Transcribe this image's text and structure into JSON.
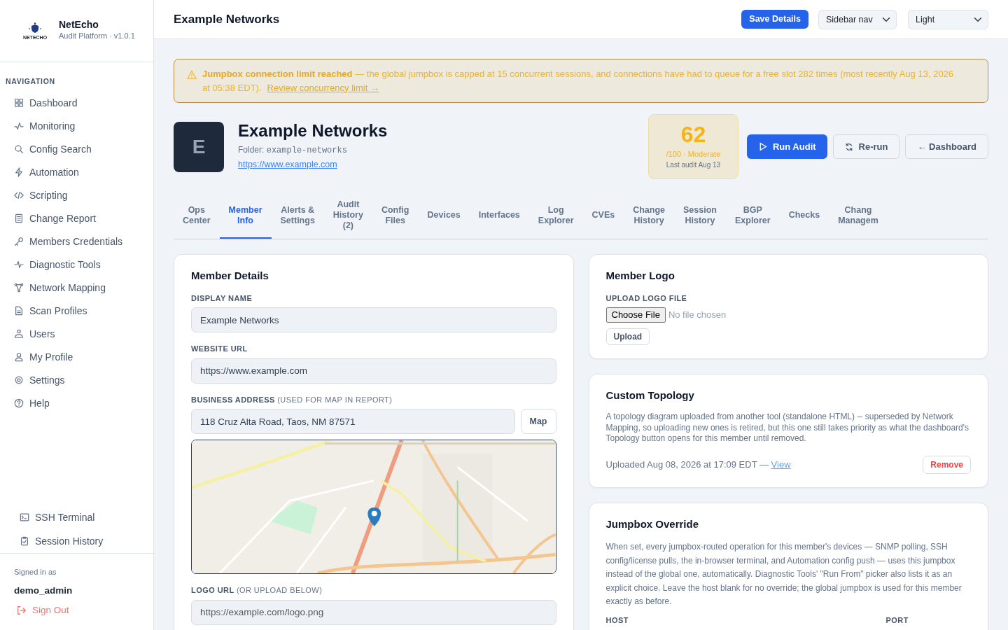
{
  "brand": {
    "logo_text": "NETECHO",
    "name": "NetEcho",
    "subtitle": "Audit Platform · v1.0.1"
  },
  "sidebar": {
    "heading": "NAVIGATION",
    "items": [
      {
        "label": "Dashboard"
      },
      {
        "label": "Monitoring"
      },
      {
        "label": "Config Search"
      },
      {
        "label": "Automation"
      },
      {
        "label": "Scripting"
      },
      {
        "label": "Change Report"
      },
      {
        "label": "Members Credentials"
      },
      {
        "label": "Diagnostic Tools"
      },
      {
        "label": "Network Mapping"
      },
      {
        "label": "Scan Profiles"
      },
      {
        "label": "Users"
      },
      {
        "label": "My Profile"
      },
      {
        "label": "Settings"
      },
      {
        "label": "Help"
      }
    ],
    "bottom_items": [
      {
        "label": "SSH Terminal"
      },
      {
        "label": "Session History"
      }
    ],
    "signed_in_label": "Signed in as",
    "user": "demo_admin",
    "sign_out": "Sign Out"
  },
  "header": {
    "title": "Example Networks",
    "save_button": "Save Details",
    "selects": [
      {
        "value": "Sidebar nav"
      },
      {
        "value": "Light"
      }
    ]
  },
  "alert": {
    "title": "Jumpbox connection limit reached",
    "text": " — the global jumpbox is capped at 15 concurrent sessions, and connections have had to queue for a free slot 282 times (most recently Aug 13, 2026 at 05:38 EDT).",
    "link": "Review concurrency limit →"
  },
  "member": {
    "initial": "E",
    "name": "Example Networks",
    "folder_label": "Folder:",
    "folder": "example-networks",
    "url": "https://www.example.com",
    "score": {
      "value": "62",
      "rating": "/100 · Moderate",
      "last_audit": "Last audit Aug 13"
    },
    "buttons": [
      {
        "label": "Run Audit",
        "kind": "primary"
      },
      {
        "label": "Re-run",
        "kind": "rerun"
      },
      {
        "label": "← Dashboard",
        "kind": "back"
      }
    ]
  },
  "tabs": [
    {
      "label": "Ops Center",
      "selected": false
    },
    {
      "label": "Member Info",
      "selected": true
    },
    {
      "label": "Alerts & Settings",
      "selected": false
    },
    {
      "label": "Audit History (2)",
      "selected": false
    },
    {
      "label": "Config Files",
      "selected": false
    },
    {
      "label": "Devices",
      "selected": false
    },
    {
      "label": "Interfaces",
      "selected": false
    },
    {
      "label": "Log Explorer",
      "selected": false
    },
    {
      "label": "CVEs",
      "selected": false
    },
    {
      "label": "Change History",
      "selected": false
    },
    {
      "label": "Session History",
      "selected": false
    },
    {
      "label": "BGP Explorer",
      "selected": false
    },
    {
      "label": "Checks",
      "selected": false
    },
    {
      "label": "Chang Managem",
      "selected": false
    }
  ],
  "member_details": {
    "title": "Member Details",
    "fields": [
      {
        "label": "DISPLAY NAME",
        "value": "Example Networks"
      },
      {
        "label": "WEBSITE URL",
        "value": "https://www.example.com"
      },
      {
        "label": "BUSINESS ADDRESS",
        "hint": "(USED FOR MAP IN REPORT)",
        "value": "118 Cruz Alta Road, Taos, NM 87571",
        "button": "Map"
      },
      {
        "label": "LOGO URL",
        "hint": "(OR UPLOAD BELOW)",
        "placeholder": "https://example.com/logo.png"
      }
    ]
  },
  "member_logo": {
    "title": "Member Logo",
    "label": "UPLOAD LOGO FILE",
    "file_button": "Choose File",
    "file_status": "No file chosen",
    "upload_button": "Upload"
  },
  "custom_topology": {
    "title": "Custom Topology",
    "text": "A topology diagram uploaded from another tool (standalone HTML) -- superseded by Network Mapping, so uploading new ones is retired, but this one still takes priority as what the dashboard's Topology button opens for this member until removed.",
    "uploaded": "Uploaded Aug 08, 2026 at 17:09 EDT — ",
    "view_link": "View",
    "remove_button": "Remove"
  },
  "jumpbox_override": {
    "title": "Jumpbox Override",
    "text": "When set, every jumpbox-routed operation for this member's devices — SNMP polling, SSH config/license pulls, the in-browser terminal, and Automation config push — uses this jumpbox instead of the global one, automatically. Diagnostic Tools' \"Run From\" picker also lists it as an explicit choice. Leave the host blank for no override; the global jumpbox is used for this member exactly as before.",
    "host_label": "HOST",
    "port_label": "PORT"
  }
}
